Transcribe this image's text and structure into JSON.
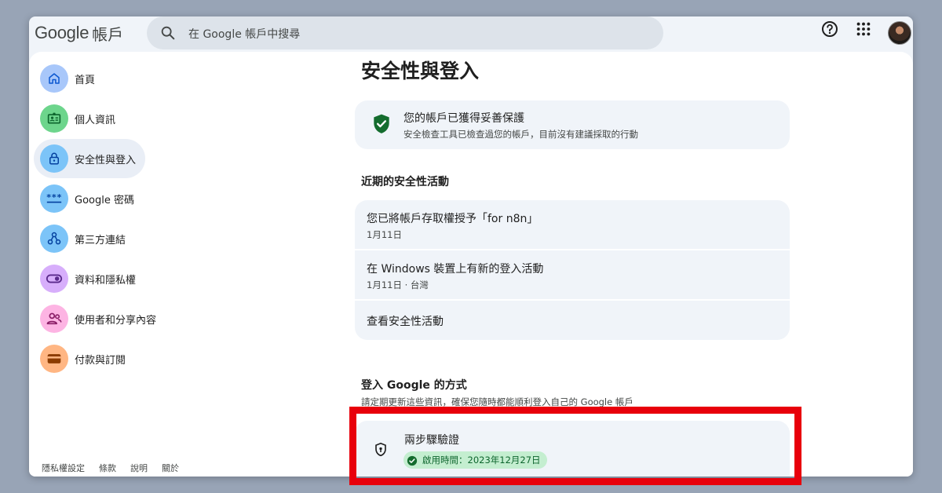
{
  "header": {
    "brand_google": "Google",
    "brand_product": "帳戶",
    "search_placeholder": "在 Google 帳戶中搜尋",
    "icons": [
      "search-icon",
      "help-icon",
      "apps-grid-icon",
      "avatar"
    ]
  },
  "sidebar": {
    "items": [
      {
        "label": "首頁",
        "icon": "home-icon",
        "color": "#a8c7fa"
      },
      {
        "label": "個人資訊",
        "icon": "id-card-icon",
        "color": "#6dd58c"
      },
      {
        "label": "安全性與登入",
        "icon": "lock-icon",
        "color": "#7cc4f8",
        "active": true
      },
      {
        "label": "Google 密碼",
        "icon": "password-icon",
        "color": "#7cc4f8"
      },
      {
        "label": "第三方連結",
        "icon": "connections-icon",
        "color": "#7cc4f8"
      },
      {
        "label": "資料和隱私權",
        "icon": "toggle-icon",
        "color": "#d7aefb"
      },
      {
        "label": "使用者和分享內容",
        "icon": "people-icon",
        "color": "#fdb4e3"
      },
      {
        "label": "付款與訂閱",
        "icon": "wallet-icon",
        "color": "#ffb683"
      }
    ],
    "footer": [
      "隱私權設定",
      "條款",
      "說明",
      "關於"
    ]
  },
  "main": {
    "title": "安全性與登入",
    "protection": {
      "title": "您的帳戶已獲得妥善保護",
      "subtitle": "安全檢查工具已檢查過您的帳戶，目前沒有建議採取的行動"
    },
    "recent_activity": {
      "title": "近期的安全性活動",
      "items": [
        {
          "title": "您已將帳戶存取權授予「for n8n」",
          "subtitle": "1月11日"
        },
        {
          "title": "在 Windows 裝置上有新的登入活動",
          "subtitle": "1月11日 · 台灣"
        },
        {
          "title": "查看安全性活動",
          "subtitle": ""
        }
      ]
    },
    "signin": {
      "title": "登入 Google 的方式",
      "subtitle": "請定期更新這些資訊，確保您隨時都能順利登入自己的 Google 帳戶",
      "two_step": {
        "title": "兩步驟驗證",
        "badge": "啟用時間：2023年12月27日"
      }
    }
  },
  "colors": {
    "background": "#98a4b6",
    "highlight": "#e8000b",
    "shield_green": "#146c2e",
    "badge_bg": "#c4eed0"
  }
}
